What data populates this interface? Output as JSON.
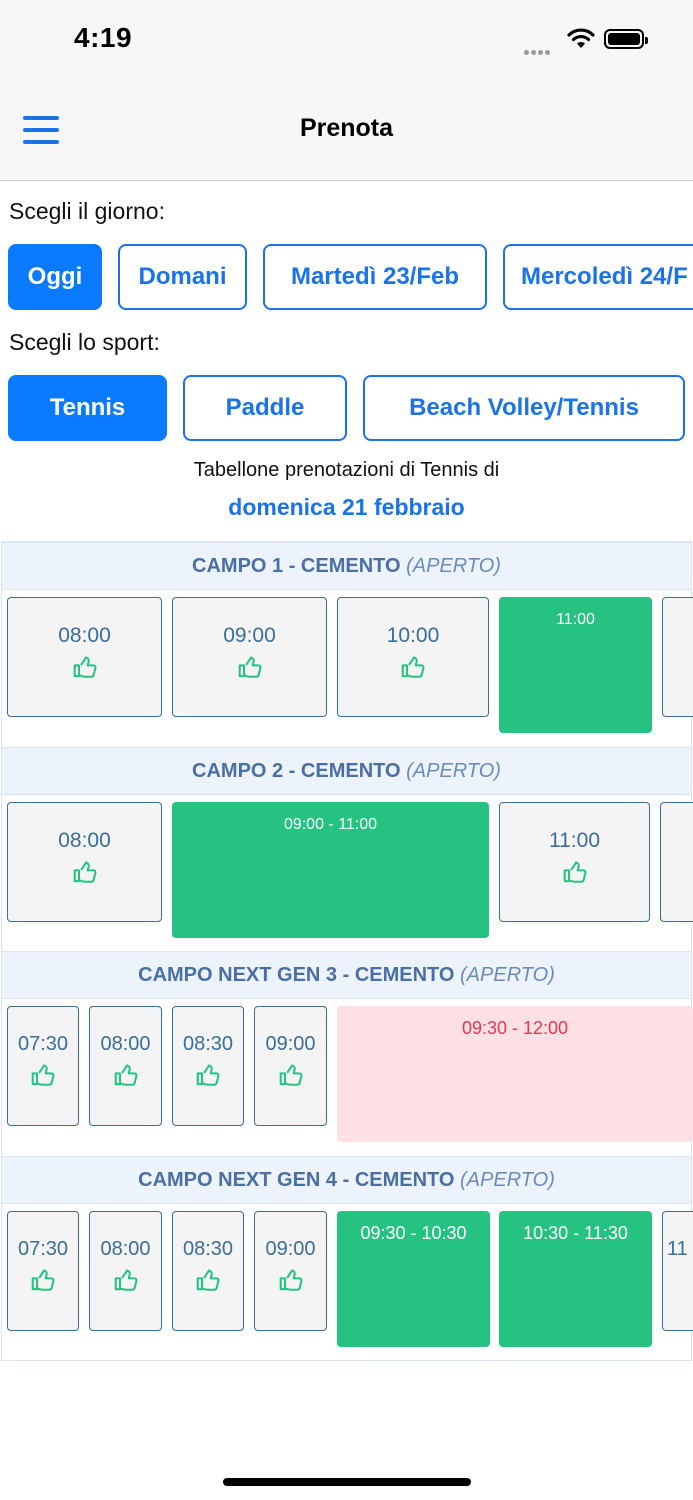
{
  "status": {
    "time": "4:19"
  },
  "nav": {
    "title": "Prenota"
  },
  "day_section": {
    "label": "Scegli il giorno:",
    "days": [
      "Oggi",
      "Domani",
      "Martedì 23/Feb",
      "Mercoledì 24/F"
    ]
  },
  "sport_section": {
    "label": "Scegli lo sport:",
    "sports": [
      "Tennis",
      "Paddle",
      "Beach Volley/Tennis"
    ]
  },
  "board": {
    "caption": "Tabellone prenotazioni di Tennis di",
    "date": "domenica 21 febbraio"
  },
  "courts": [
    {
      "name": "CAMPO 1 - CEMENTO",
      "status": "(APERTO)",
      "slots": [
        "08:00",
        "09:00",
        "10:00"
      ],
      "booked": [
        "11:00"
      ]
    },
    {
      "name": "CAMPO 2 - CEMENTO",
      "status": "(APERTO)",
      "slots": [
        "08:00",
        "11:00"
      ],
      "booked": [
        "09:00 - 11:00"
      ]
    },
    {
      "name": "CAMPO NEXT GEN 3 - CEMENTO",
      "status": "(APERTO)",
      "slots": [
        "07:30",
        "08:00",
        "08:30",
        "09:00"
      ],
      "reserved": [
        "09:30 - 12:00"
      ]
    },
    {
      "name": "CAMPO NEXT GEN 4 - CEMENTO",
      "status": "(APERTO)",
      "slots": [
        "07:30",
        "08:00",
        "08:30",
        "09:00",
        "11"
      ],
      "booked": [
        "09:30 - 10:30",
        "10:30 - 11:30"
      ]
    }
  ],
  "colors": {
    "primary": "#0a7aff",
    "booked": "#26c281",
    "reserved_bg": "#fde0e4",
    "reserved_text": "#e03a52",
    "slot_border": "#3a6d99",
    "court_header": "#edf3fc"
  },
  "icons": {
    "menu": "hamburger-icon",
    "available": "thumbs-up-icon",
    "wifi": "wifi-icon",
    "battery": "battery-icon"
  }
}
